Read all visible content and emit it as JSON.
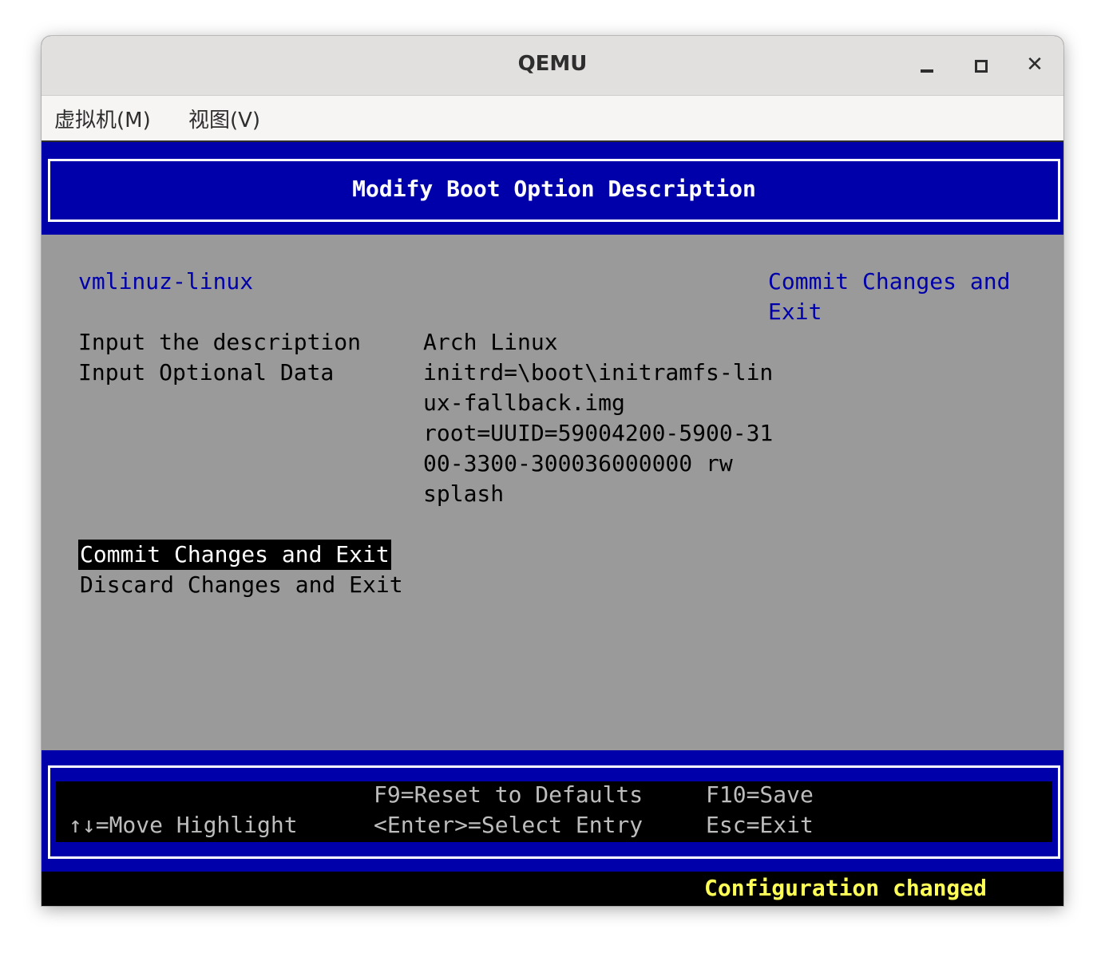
{
  "window": {
    "title": "QEMU",
    "controls": {
      "minimize": "minimize-icon",
      "maximize": "maximize-icon",
      "close": "close-icon",
      "close_glyph": "✕"
    }
  },
  "menubar": {
    "items": [
      {
        "label": "虚拟机(M)"
      },
      {
        "label": "视图(V)"
      }
    ]
  },
  "bios": {
    "header": "Modify Boot Option Description",
    "entry_name": "vmlinuz-linux",
    "help_text": [
      "Commit Changes and",
      "Exit"
    ],
    "fields": [
      {
        "label": "Input the description",
        "value": [
          "Arch Linux"
        ]
      },
      {
        "label": "Input Optional Data",
        "value": [
          "initrd=\\boot\\initramfs-lin",
          "ux-fallback.img",
          "root=UUID=59004200-5900-31",
          "00-3300-300036000000 rw",
          "splash"
        ]
      }
    ],
    "actions": [
      {
        "label": "Commit Changes and Exit",
        "selected": true
      },
      {
        "label": "Discard Changes and Exit",
        "selected": false
      }
    ],
    "footer": {
      "nav": "↑↓=Move Highlight",
      "reset": "F9=Reset to Defaults",
      "select": "<Enter>=Select Entry",
      "save": "F10=Save",
      "exit": "Esc=Exit"
    },
    "status": "Configuration changed"
  },
  "colors": {
    "bios_blue": "#0000aa",
    "bios_gray": "#9a9a9a",
    "status_yellow": "#ffff55",
    "footer_text": "#bdbdbd"
  }
}
